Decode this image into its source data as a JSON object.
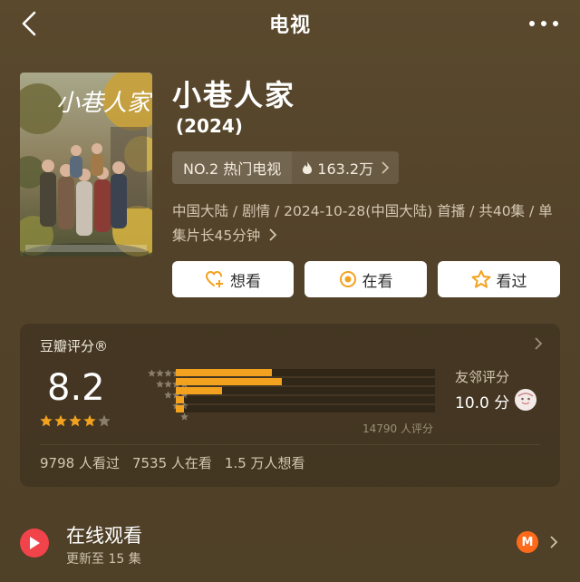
{
  "nav": {
    "title": "电视",
    "back_icon": "chevron-left-icon",
    "more_icon": "more-dots-icon"
  },
  "show": {
    "title": "小巷人家",
    "year": "(2024)",
    "rank": "NO.2 热门电视",
    "heat": "163.2万",
    "meta": "中国大陆 / 剧情 / 2024-10-28(中国大陆) 首播 / 共40集 / 单集片长45分钟",
    "poster_title": "小巷人家"
  },
  "actions": {
    "want": "想看",
    "watching": "在看",
    "watched": "看过"
  },
  "rating": {
    "title": "豆瓣评分®",
    "score": "8.2",
    "score_stars": 4,
    "distribution_fraction": [
      0.37,
      0.41,
      0.18,
      0.03,
      0.03
    ],
    "count": "14790 人评分",
    "friend_label": "友邻评分",
    "friend_score": "10.0 分",
    "stats": [
      "9798 人看过",
      "7535 人在看",
      "1.5 万人想看"
    ]
  },
  "online": {
    "title": "在线观看",
    "subtitle": "更新至 15 集",
    "platform_initial": "M"
  },
  "colors": {
    "background": "#55452b",
    "accent": "#f3a21f",
    "play": "#f0434a",
    "platform": "#ff6a1a"
  }
}
